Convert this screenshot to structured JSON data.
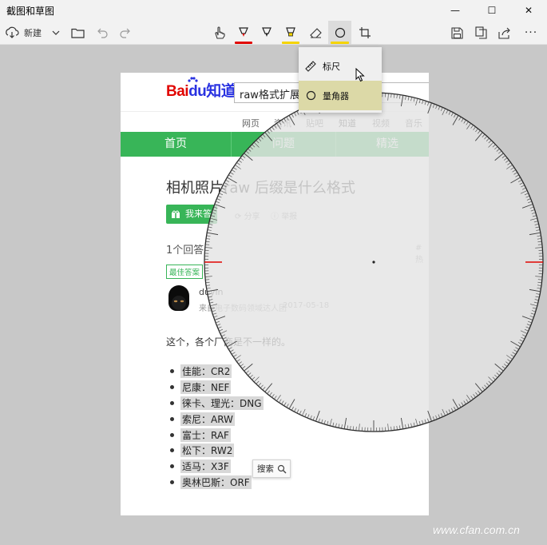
{
  "app": {
    "title": "截图和草图"
  },
  "window_controls": {
    "minimize": "—",
    "maximize": "☐",
    "close": "✕"
  },
  "toolbar": {
    "new_label": "新建",
    "items": [
      "touch-writing-icon",
      "ballpoint-pen-icon",
      "pencil-icon",
      "highlighter-icon",
      "eraser-icon",
      "protractor-icon",
      "crop-icon"
    ],
    "more": "···"
  },
  "menu": {
    "items": [
      {
        "label": "标尺",
        "icon": "ruler-icon"
      },
      {
        "label": "量角器",
        "icon": "protractor-icon"
      }
    ]
  },
  "page": {
    "logo": {
      "part1": "Bai",
      "part2": "du",
      "part3": "知道"
    },
    "search_value": "raw格式扩展名",
    "nav": [
      "网页",
      "资讯",
      "贴吧",
      "知道",
      "视频",
      "音乐"
    ],
    "tabs": [
      "首页",
      "问题",
      "精选"
    ],
    "question_title": "相机照片raw 后缀是什么格式",
    "answer_button": "我来答",
    "share": "分享",
    "report": "举报",
    "answer_count": "1个回答",
    "hot_tag": "#热",
    "best_answer": "最佳答案",
    "user_name": "duyin",
    "user_meta": "来自电子数码领域达人团",
    "date": "2017-05-18",
    "answer_intro": "这个，各个厂商是不一样的。",
    "brands": [
      "佳能：CR2",
      "尼康：NEF",
      "徕卡、理光：DNG",
      "索尼：ARW",
      "富士：RAF",
      "松下：RW2",
      "适马：X3F",
      "奥林巴斯：ORF"
    ],
    "search_popup": "搜索"
  },
  "colors": {
    "red": "#e10602",
    "yellow": "#f5d400",
    "green": "#38b558",
    "highlight": "#dcd9a7"
  },
  "watermark": "www.cfan.com.cn"
}
